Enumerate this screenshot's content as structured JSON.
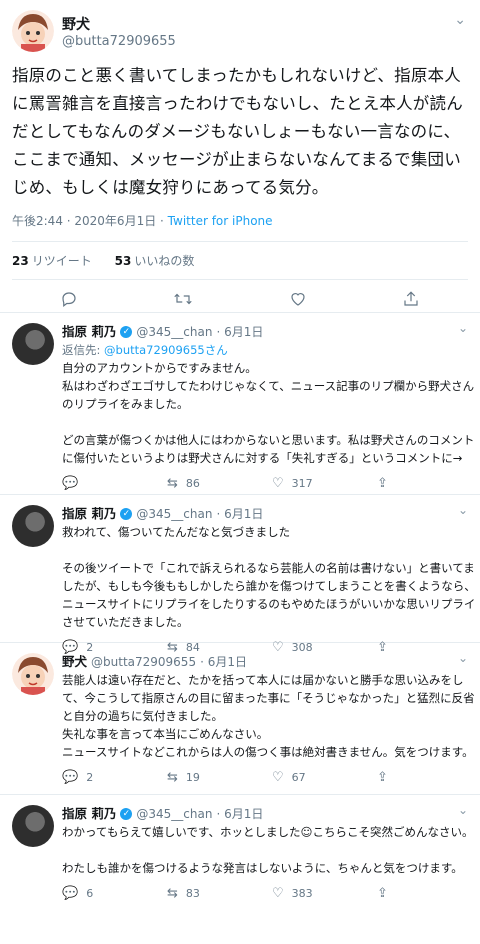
{
  "main": {
    "display_name": "野犬",
    "handle": "@butta72909655",
    "text": "指原のこと悪く書いてしまったかもしれないけど、指原本人に罵詈雑言を直接言ったわけでもないし、たとえ本人が読んだとしてもなんのダメージもないしょーもない一言なのに、ここまで通知、メッセージが止まらないなんてまるで集団いじめ、もしくは魔女狩りにあってる気分。",
    "time": "午後2:44 · 2020年6月1日 ·",
    "source": "Twitter for iPhone",
    "retweets": "23",
    "retweets_label": "リツイート",
    "likes": "53",
    "likes_label": "いいねの数"
  },
  "icons": {
    "reply": "reply-icon",
    "retweet": "retweet-icon",
    "like": "heart-icon",
    "share": "share-icon",
    "more": "chevron-down-icon",
    "verified": "verified-badge-icon"
  },
  "replies": [
    {
      "display_name": "指原 莉乃",
      "handle": "@345__chan",
      "date": "· 6月1日",
      "replying_label": "返信先:",
      "replying_to": "@butta72909655",
      "replying_suffix": "さん",
      "text": "自分のアカウントからですみません。\n私はわざわざエゴサしてたわけじゃなくて、ニュース記事のリプ欄から野犬さんのリプライをみました。\n\nどの言葉が傷つくかは他人にはわからないと思います。私は野犬さんのコメントに傷付いたというよりは野犬さんに対する「失礼すぎる」というコメントに→",
      "reply_count": "",
      "retweet_count": "86",
      "like_count": "317"
    },
    {
      "display_name": "指原 莉乃",
      "handle": "@345__chan",
      "date": "· 6月1日",
      "text": "救われて、傷ついてたんだなと気づきました\n\nその後ツイートで「これで訴えられるなら芸能人の名前は書けない」と書いてましたが、もしも今後ももしかしたら誰かを傷つけてしまうことを書くようなら、ニュースサイトにリプライをしたりするのもやめたほうがいいかな思いリプライさせていただきました。",
      "reply_count": "2",
      "retweet_count": "84",
      "like_count": "308"
    },
    {
      "display_name": "野犬",
      "handle": "@butta72909655",
      "date": "· 6月1日",
      "text": "芸能人は遠い存在だと、たかを括って本人には届かないと勝手な思い込みをして、今こうして指原さんの目に留まった事に「そうじゃなかった」と猛烈に反省と自分の過ちに気付きました。\n失礼な事を言って本当にごめんなさい。\nニュースサイトなどこれからは人の傷つく事は絶対書きません。気をつけます。",
      "reply_count": "2",
      "retweet_count": "19",
      "like_count": "67"
    },
    {
      "display_name": "指原 莉乃",
      "handle": "@345__chan",
      "date": "· 6月1日",
      "text": "わかってもらえて嬉しいです、ホッとしました☺こちらこそ突然ごめんなさい。\n\nわたしも誰かを傷つけるような発言はしないように、ちゃんと気をつけます。",
      "reply_count": "6",
      "retweet_count": "83",
      "like_count": "383"
    }
  ]
}
